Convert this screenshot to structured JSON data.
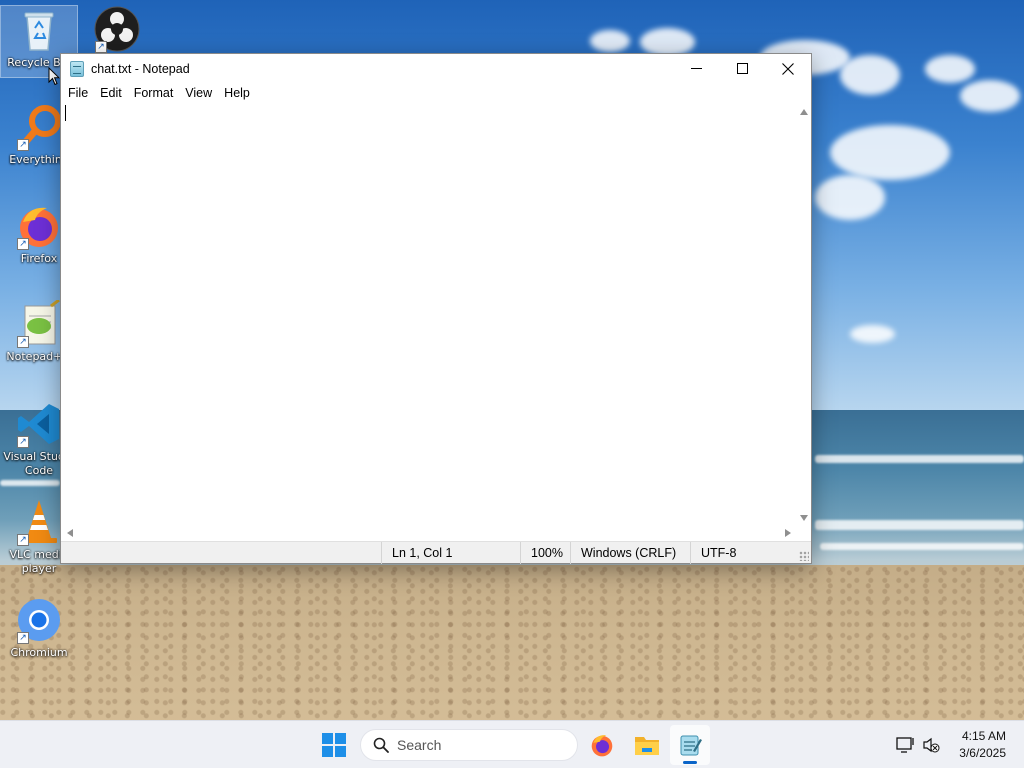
{
  "desktop": {
    "icons": [
      {
        "name": "recycle-bin",
        "label": "Recycle Bin"
      },
      {
        "name": "obs-studio",
        "label": ""
      },
      {
        "name": "everything",
        "label": "Everything"
      },
      {
        "name": "firefox",
        "label": "Firefox"
      },
      {
        "name": "notepad-plus-plus",
        "label": "Notepad++"
      },
      {
        "name": "vscode",
        "label": "Visual Studio\nCode"
      },
      {
        "name": "vlc",
        "label": "VLC media\nplayer"
      },
      {
        "name": "chromium",
        "label": "Chromium"
      }
    ]
  },
  "notepad": {
    "title": "chat.txt - Notepad",
    "menu": [
      "File",
      "Edit",
      "Format",
      "View",
      "Help"
    ],
    "content": "",
    "status": {
      "position": "Ln 1, Col 1",
      "zoom": "100%",
      "line_ending": "Windows (CRLF)",
      "encoding": "UTF-8"
    }
  },
  "taskbar": {
    "search_placeholder": "Search",
    "apps": [
      "start",
      "search",
      "firefox",
      "file-explorer",
      "notepad"
    ],
    "active_app": "notepad",
    "clock": {
      "time": "4:15 AM",
      "date": "3/6/2025"
    }
  },
  "colors": {
    "accent": "#0a64c8",
    "window_bg": "#ffffff",
    "statusbar_bg": "#f0f0f0",
    "taskbar_bg": "#eef0f5"
  }
}
